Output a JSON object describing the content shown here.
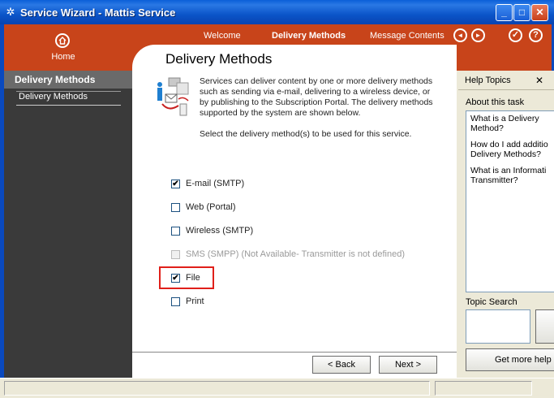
{
  "window": {
    "title": "Service Wizard - Mattis Service",
    "minimize_label": "_",
    "maximize_label": "□",
    "close_label": "✕"
  },
  "header": {
    "home_label": "Home",
    "nav": [
      "Welcome",
      "Delivery Methods",
      "Message Contents"
    ],
    "active_index": 1,
    "back_icon": "◄",
    "forward_icon": "►",
    "finish_icon": "✓",
    "help_icon": "?"
  },
  "sidebar": {
    "section_title": "Delivery Methods",
    "items": [
      "Delivery Methods"
    ]
  },
  "main": {
    "title": "Delivery Methods",
    "description": "Services can deliver content by one or more delivery methods such as sending via e-mail, delivering to a wireless device, or by publishing to the Subscription Portal.  The delivery methods supported by the system are shown below.",
    "instruction": "Select the delivery method(s) to be used for this service.",
    "options": [
      {
        "label": "E-mail (SMTP)",
        "checked": true,
        "enabled": true,
        "check": "✔"
      },
      {
        "label": "Web (Portal)",
        "checked": false,
        "enabled": true,
        "check": ""
      },
      {
        "label": "Wireless (SMTP)",
        "checked": false,
        "enabled": true,
        "check": ""
      },
      {
        "label": "SMS (SMPP) (Not Available- Transmitter is not defined)",
        "checked": false,
        "enabled": false,
        "check": ""
      },
      {
        "label": "File",
        "checked": true,
        "enabled": true,
        "check": "✔"
      },
      {
        "label": "Print",
        "checked": false,
        "enabled": true,
        "check": ""
      }
    ],
    "back_button": "< Back",
    "next_button": "Next >"
  },
  "help": {
    "title": "Help Topics",
    "close_label": "✕",
    "about_label": "About this task",
    "topics": [
      "What is a Delivery\nMethod?",
      "How do I add additio\nDelivery Methods?",
      "What is an Informati\nTransmitter?"
    ],
    "topic_search_label": "Topic Search",
    "more_help_label": "Get more help"
  },
  "colors": {
    "accent": "#c8441a",
    "titlebar": "#0a5fd8",
    "sidebar": "#3a3a3a",
    "highlight": "#e0201a"
  }
}
